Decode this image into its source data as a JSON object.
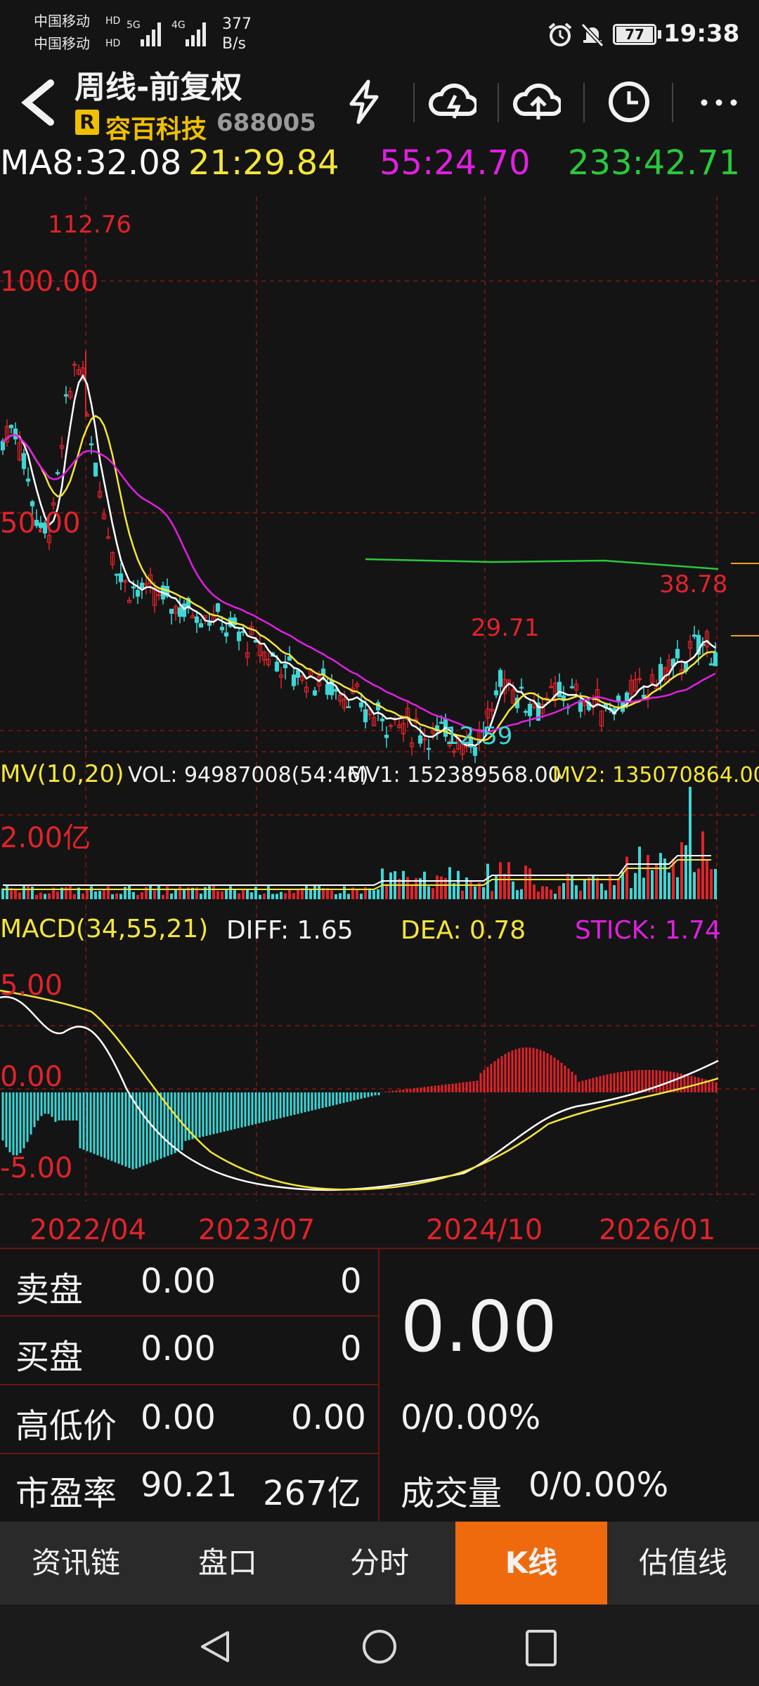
{
  "status_bar": {
    "carrier1": "中国移动",
    "carrier2": "中国移动",
    "net1": "5G",
    "net2": "4G",
    "speed_value": "377",
    "speed_unit": "B/s",
    "battery": "77",
    "time": "19:38"
  },
  "header": {
    "title": "周线-前复权",
    "badge": "R",
    "stock_name": "容百科技",
    "stock_code": "688005",
    "icons": [
      "back-arrow-icon",
      "lightning-icon",
      "cloud-download-icon",
      "cloud-upload-icon",
      "clock-icon",
      "more-icon"
    ]
  },
  "ma_legend": {
    "ma8": "MA8:32.08",
    "ma21": "21:29.84",
    "ma55": "55:24.70",
    "ma233": "233:42.71",
    "colors": {
      "ma8": "#ffffff",
      "ma21": "#f5e53a",
      "ma55": "#e020e0",
      "ma233": "#29c93a"
    }
  },
  "price_chart": {
    "labels": {
      "high": "112.76",
      "level100": "100.00",
      "level50": "50.00",
      "recent_high": "38.78",
      "mid_high": "29.71",
      "low": "12.59"
    }
  },
  "volume_panel": {
    "label": "MV(10,20)",
    "vol": "VOL: 94987008(54:46)",
    "mv1": "MV1: 152389568.00",
    "mv2": "MV2: 135070864.00",
    "axis": "2.00亿"
  },
  "macd_panel": {
    "label": "MACD(34,55,21)",
    "diff": "DIFF: 1.65",
    "dea": "DEA: 0.78",
    "stick": "STICK: 1.74",
    "axis_top": "5.00",
    "axis_zero": "0.00",
    "axis_bottom": "-5.00"
  },
  "date_axis": [
    "2022/04",
    "2023/07",
    "2024/10",
    "2026/01"
  ],
  "quote": {
    "rows": [
      {
        "label": "卖盘",
        "v1": "0.00",
        "v2": "0"
      },
      {
        "label": "买盘",
        "v1": "0.00",
        "v2": "0"
      },
      {
        "label": "高低价",
        "v1": "0.00",
        "v2": "0.00"
      },
      {
        "label": "市盈率",
        "v1": "90.21",
        "v2": "267亿"
      }
    ],
    "price": "0.00",
    "change": "0/0.00%",
    "volume_label": "成交量",
    "volume_value": "0/0.00%"
  },
  "tabs": [
    {
      "label": "资讯链",
      "active": false
    },
    {
      "label": "盘口",
      "active": false
    },
    {
      "label": "分时",
      "active": false
    },
    {
      "label": "K线",
      "active": true
    },
    {
      "label": "估值线",
      "active": false
    }
  ],
  "chart_data": {
    "type": "candlestick",
    "title": "周线-前复权",
    "x_ticks": [
      "2022/04",
      "2023/07",
      "2024/10",
      "2026/01"
    ],
    "price_ylim": [
      12.59,
      112.76
    ],
    "annotations": [
      {
        "label": "112.76",
        "kind": "max"
      },
      {
        "label": "12.59",
        "kind": "min"
      },
      {
        "label": "29.71",
        "kind": "local-high"
      },
      {
        "label": "38.78",
        "kind": "local-high"
      }
    ],
    "series": [
      {
        "name": "MA8",
        "last": 32.08
      },
      {
        "name": "MA21",
        "last": 29.84
      },
      {
        "name": "MA55",
        "last": 24.7
      },
      {
        "name": "MA233",
        "last": 42.71
      }
    ],
    "volume": {
      "vol": 94987008,
      "mv1": 152389568.0,
      "mv2": 135070864.0,
      "axis_label": "2.00亿"
    },
    "macd": {
      "params": "34,55,21",
      "diff": 1.65,
      "dea": 0.78,
      "stick": 1.74,
      "ylim": [
        -5.0,
        5.0
      ]
    }
  }
}
